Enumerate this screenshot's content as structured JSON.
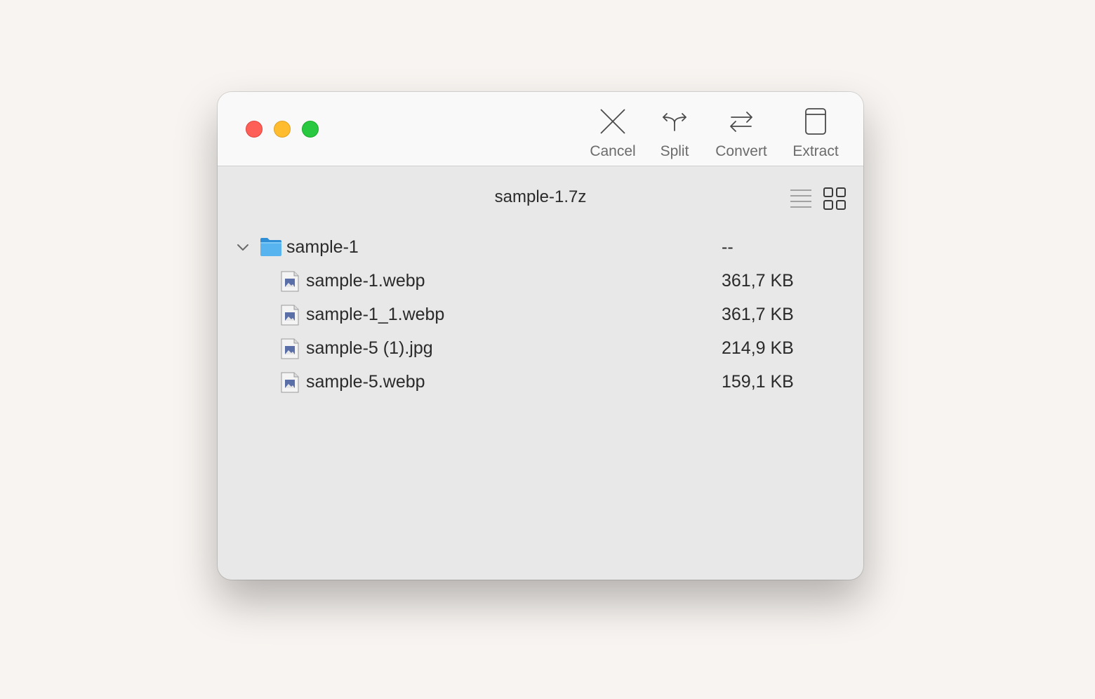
{
  "toolbar": {
    "cancel_label": "Cancel",
    "split_label": "Split",
    "convert_label": "Convert",
    "extract_label": "Extract"
  },
  "archive": {
    "title": "sample-1.7z"
  },
  "view_modes": [
    "list",
    "grid"
  ],
  "tree": {
    "folder": {
      "name": "sample-1",
      "size": "--",
      "icon": "folder-icon",
      "expanded": true
    },
    "files": [
      {
        "name": "sample-1.webp",
        "size": "361,7 KB",
        "icon": "image-file-icon"
      },
      {
        "name": "sample-1_1.webp",
        "size": "361,7 KB",
        "icon": "image-file-icon"
      },
      {
        "name": "sample-5 (1).jpg",
        "size": "214,9 KB",
        "icon": "image-file-icon"
      },
      {
        "name": "sample-5.webp",
        "size": "159,1 KB",
        "icon": "image-file-icon"
      }
    ]
  },
  "colors": {
    "background": "#f8f4f1",
    "window": "#e8e8e8",
    "titlebar": "#f9f9f9",
    "close": "#fe5f57",
    "minimize": "#febc2e",
    "maximize": "#28c840",
    "folder": "#4aa8e8"
  }
}
